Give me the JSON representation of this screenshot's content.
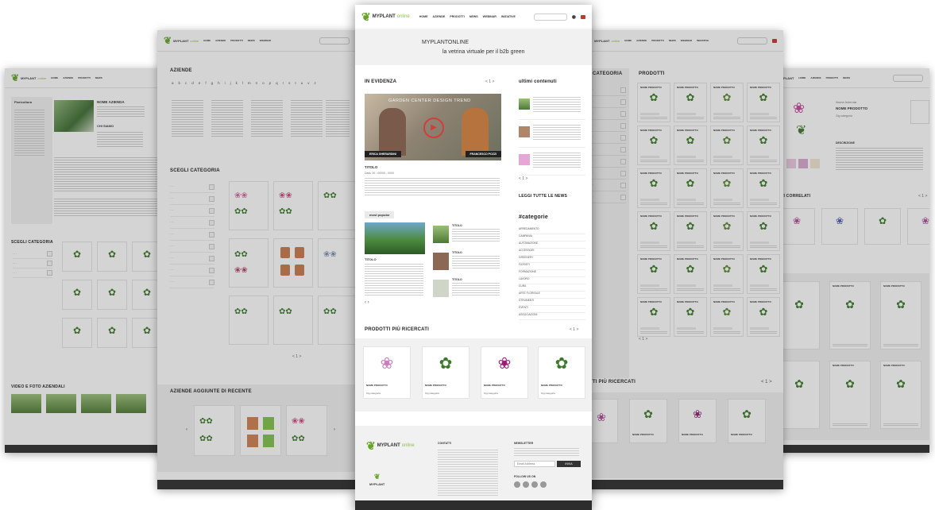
{
  "brand": {
    "name_part1": "MYPLANT",
    "name_part2": "online"
  },
  "nav": [
    "HOME",
    "AZIENDE",
    "PRODOTTI",
    "NEWS",
    "WEBINAR",
    "INIZIATIVE"
  ],
  "center": {
    "title": "MYPLANTONLINE",
    "subtitle": "la vetrina virtuale per il b2b green",
    "in_evidenza": "IN EVIDENZA",
    "pager": "< 1 >",
    "video": {
      "overlay": "GARDEN CENTER DESIGN TREND",
      "left_name": "ERICA GHERARDINI",
      "right_name": "FRANCESCO POZZI"
    },
    "article_title": "TITOLO",
    "article_date": "Data: 00 - 00000 - 0000",
    "ultimi_contenuti": "ultimi contenuti",
    "small_pager": "< 1 >",
    "leggi_news": "LEGGI TUTTE LE NEWS",
    "categorie_h": "#categorie",
    "categorie": [
      "ARREDAMENTO",
      "CAMPANIA",
      "AUTOMAZIONE",
      "ACCESSORI",
      "GREENERY",
      "FIORISTI",
      "FORMAZIONE",
      "LAVORO",
      "CURA",
      "ARTE FLOREALE",
      "STRUMENTI",
      "EVENTI",
      "ASSOCIAZIONI"
    ],
    "most_popular": "most popular",
    "pop_titles": [
      "TITOLO",
      "TITOLO",
      "TITOLO"
    ],
    "prodotti_ricercati": "PRODOTTI PIÙ RICERCATI",
    "prod_pager": "< 1 >",
    "products": [
      {
        "name": "NOME PRODOTTO",
        "cat": "Ctg categoria"
      },
      {
        "name": "NOME PRODOTTO",
        "cat": "Ctg categoria"
      },
      {
        "name": "NOME PRODOTTO",
        "cat": "Ctg categoria"
      },
      {
        "name": "NOME PRODOTTO",
        "cat": "Ctg categoria"
      }
    ],
    "footer": {
      "contatti": "CONTATTI",
      "newsletter": "NEWSLETTER",
      "email_placeholder": "Email Address",
      "submit": "INVIA",
      "follow": "FOLLOW US ON"
    }
  },
  "left2": {
    "aziende_h": "AZIENDE",
    "alphabet": [
      "a",
      "b",
      "c",
      "d",
      "e",
      "f",
      "g",
      "h",
      "i",
      "j",
      "k",
      "l",
      "m",
      "n",
      "o",
      "p",
      "q",
      "r",
      "s",
      "t",
      "u",
      "v",
      "z"
    ],
    "scegli_h": "SCEGLI CATEGORIA",
    "recenti_h": "AZIENDE AGGIUNTE DI RECENTE",
    "pager": "< 1 >"
  },
  "left1": {
    "sidebar_h": "Floricoltura",
    "company": "NOME AZIENDA",
    "chi_siamo": "CHI SIAMO",
    "scegli_h": "SCEGLI CATEGORIA",
    "video_h": "VIDEO E FOTO AZIENDALI"
  },
  "right1": {
    "categoria_h": "CATEGORIA",
    "prodotti_h": "PRODOTTI",
    "ricercati_h": "TTI PIÙ RICERCATI",
    "pager": "< 1 >",
    "product_name": "NOME PRODOTTO",
    "product_cat": "Ctg categoria"
  },
  "right2": {
    "company": "Nome Azienda",
    "product": "NOME PRODOTTO",
    "cat": "Ctg categoria",
    "descr_h": "DESCRIZIONE",
    "correlati_h": "TTI CORRELATI",
    "pager": "< 1 >"
  },
  "colors": {
    "brand_green": "#6aa32b",
    "footer_dark": "#2d2d2d",
    "accent_red": "#c0392b"
  }
}
